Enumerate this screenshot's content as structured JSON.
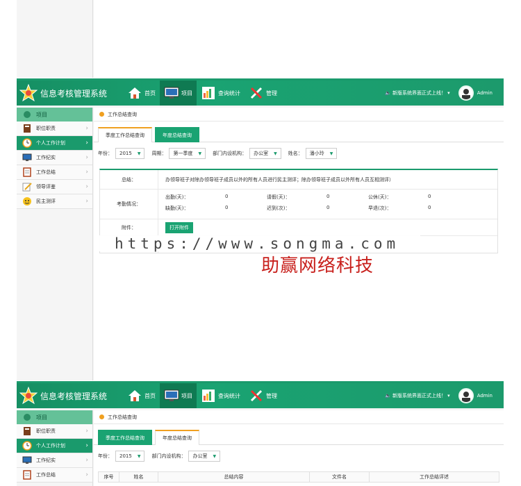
{
  "app": {
    "title": "信息考核管理系统"
  },
  "nav": [
    {
      "label": "首页",
      "icon": "home-icon"
    },
    {
      "label": "项目",
      "icon": "monitor-icon"
    },
    {
      "label": "查询统计",
      "icon": "chart-search-icon"
    },
    {
      "label": "管理",
      "icon": "tools-icon"
    }
  ],
  "header": {
    "notice": "🔈 新版系统界面正式上线！ ▾",
    "user": "Admin"
  },
  "sidebar": {
    "section": "项目",
    "items": [
      {
        "label": "职位职责",
        "icon": "book-icon"
      },
      {
        "label": "个人工作计划",
        "icon": "clock-icon"
      },
      {
        "label": "工作纪实",
        "icon": "monitor-icon"
      },
      {
        "label": "工作总结",
        "icon": "notebook-icon"
      },
      {
        "label": "领导评鉴",
        "icon": "pencil-icon"
      },
      {
        "label": "民主测评",
        "icon": "smiley-icon"
      }
    ]
  },
  "screen1": {
    "crumb": "工作总结查询",
    "tabs": [
      "季度工作总结查询",
      "年度总结查询"
    ],
    "filters": {
      "year_label": "年份：",
      "year": "2015",
      "period_label": "周期：",
      "period": "第一季度",
      "dept_label": "部门内设机构：",
      "dept": "办公室",
      "name_label": "姓名：",
      "name": "潘小玲"
    },
    "detail": {
      "summary_label": "总结：",
      "summary": "办领导班子对除办领导班子成员以外的所有人员进行民主测评；除办领导班子成员以外所有人员互相测评）",
      "attendance_label": "考勤情况：",
      "attendance": [
        [
          "出勤(天)：",
          "0",
          "请假(天)：",
          "0",
          "公休(天)：",
          "0"
        ],
        [
          "缺勤(天)：",
          "0",
          "迟到(次)：",
          "0",
          "早退(次)：",
          "0"
        ]
      ],
      "attachment_label": "附件：",
      "open_button": "打开附件"
    }
  },
  "screen2": {
    "crumb": "工作总结查询",
    "tabs": [
      "季度工作总结查询",
      "年度总结查询"
    ],
    "filters": {
      "year_label": "年份：",
      "year": "2015",
      "dept_label": "部门内设机构：",
      "dept": "办公室"
    },
    "table_headers": [
      "序号",
      "姓名",
      "总结内容",
      "文件名",
      "工作总结评述"
    ]
  },
  "watermark": {
    "url": "https://www.songma.com",
    "brand": "助赢网络科技"
  },
  "colors": {
    "primary": "#1a9a6c",
    "accent": "#f0a020",
    "brand_red": "#c8201c"
  }
}
